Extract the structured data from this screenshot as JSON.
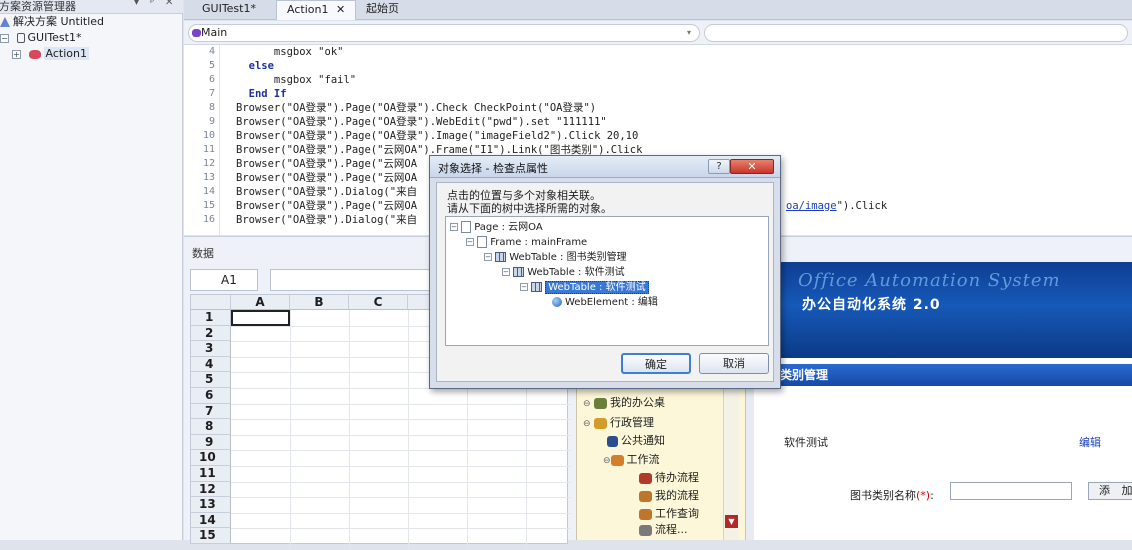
{
  "explorer": {
    "title": "方案资源管理器",
    "controls": [
      "▾",
      "ᵖ",
      "✕"
    ],
    "solution": "解决方案 Untitled",
    "project": "GUITest1*",
    "action": "Action1"
  },
  "tabs": [
    {
      "label": "GUITest1*"
    },
    {
      "label": "Action1"
    },
    {
      "label": "起始页"
    }
  ],
  "tab_close": "✕",
  "navbar": {
    "main_select": "Main"
  },
  "editor": {
    "lines": [
      {
        "no": "4",
        "text": "      msgbox \"ok\""
      },
      {
        "no": "5",
        "text": "  else"
      },
      {
        "no": "6",
        "text": "      msgbox \"fail\""
      },
      {
        "no": "7",
        "text": "  End If"
      },
      {
        "no": "8",
        "text": "Browser(\"OA登录\").Page(\"OA登录\").Check CheckPoint(\"OA登录\")"
      },
      {
        "no": "9",
        "text": "Browser(\"OA登录\").Page(\"OA登录\").WebEdit(\"pwd\").set \"111111\""
      },
      {
        "no": "10",
        "text": "Browser(\"OA登录\").Page(\"OA登录\").Image(\"imageField2\").Click 20,10"
      },
      {
        "no": "11",
        "text": "Browser(\"OA登录\").Page(\"云网OA\").Frame(\"I1\").Link(\"图书类别\").Click"
      },
      {
        "no": "12",
        "text": "Browser(\"OA登录\").Page(\"云网OA"
      },
      {
        "no": "13",
        "text": "Browser(\"OA登录\").Page(\"云网OA"
      },
      {
        "no": "14",
        "text": "Browser(\"OA登录\").Dialog(\"来自"
      },
      {
        "no": "15",
        "text": "Browser(\"OA登录\").Page(\"云网OA"
      },
      {
        "no": "16",
        "text": "Browser(\"OA登录\").Dialog(\"来自"
      }
    ],
    "line15_tail_link": "oa/image",
    "line15_tail_rest": "\").Click"
  },
  "data_panel": {
    "title": "数据",
    "cell_ref": "A1",
    "columns": [
      "A",
      "B",
      "C"
    ],
    "rows": [
      "1",
      "2",
      "3",
      "4",
      "5",
      "6",
      "7",
      "8",
      "9",
      "10",
      "11",
      "12",
      "13",
      "14",
      "15"
    ]
  },
  "webapp": {
    "banner_en": "Office Automation System",
    "banner_cn": "办公自动化系统 2.0",
    "category_bar": "类别管理",
    "row_label": "软件测试",
    "row_edit": "编辑",
    "name_label": "图书类别名称",
    "name_required": "(*)",
    "name_colon": ":",
    "add_button": "添 加",
    "nav": [
      {
        "label": "我的办公桌",
        "color": "#6b7f3a"
      },
      {
        "label": "行政管理",
        "color": "#d49b2a"
      },
      {
        "label": "公共通知",
        "color": "#2d4e8c"
      },
      {
        "label": "工作流",
        "color": "#d4802a"
      },
      {
        "label": "待办流程",
        "color": "#b23a2a"
      },
      {
        "label": "我的流程",
        "color": "#c0762a"
      },
      {
        "label": "工作查询",
        "color": "#c0762a"
      },
      {
        "label": "流程...",
        "color": "#7a7a7a"
      }
    ]
  },
  "dialog": {
    "title": "对象选择 - 检查点属性",
    "help": "?",
    "close": "✕",
    "message1": "点击的位置与多个对象相关联。",
    "message2": "请从下面的树中选择所需的对象。",
    "tree": [
      {
        "label": "Page : 云网OA"
      },
      {
        "label": "Frame : mainFrame"
      },
      {
        "label": "WebTable : 图书类别管理"
      },
      {
        "label": "WebTable : 软件测试"
      },
      {
        "label": "WebTable : 软件测试"
      },
      {
        "label": "WebElement : 编辑"
      }
    ],
    "ok": "确定",
    "cancel": "取消"
  }
}
